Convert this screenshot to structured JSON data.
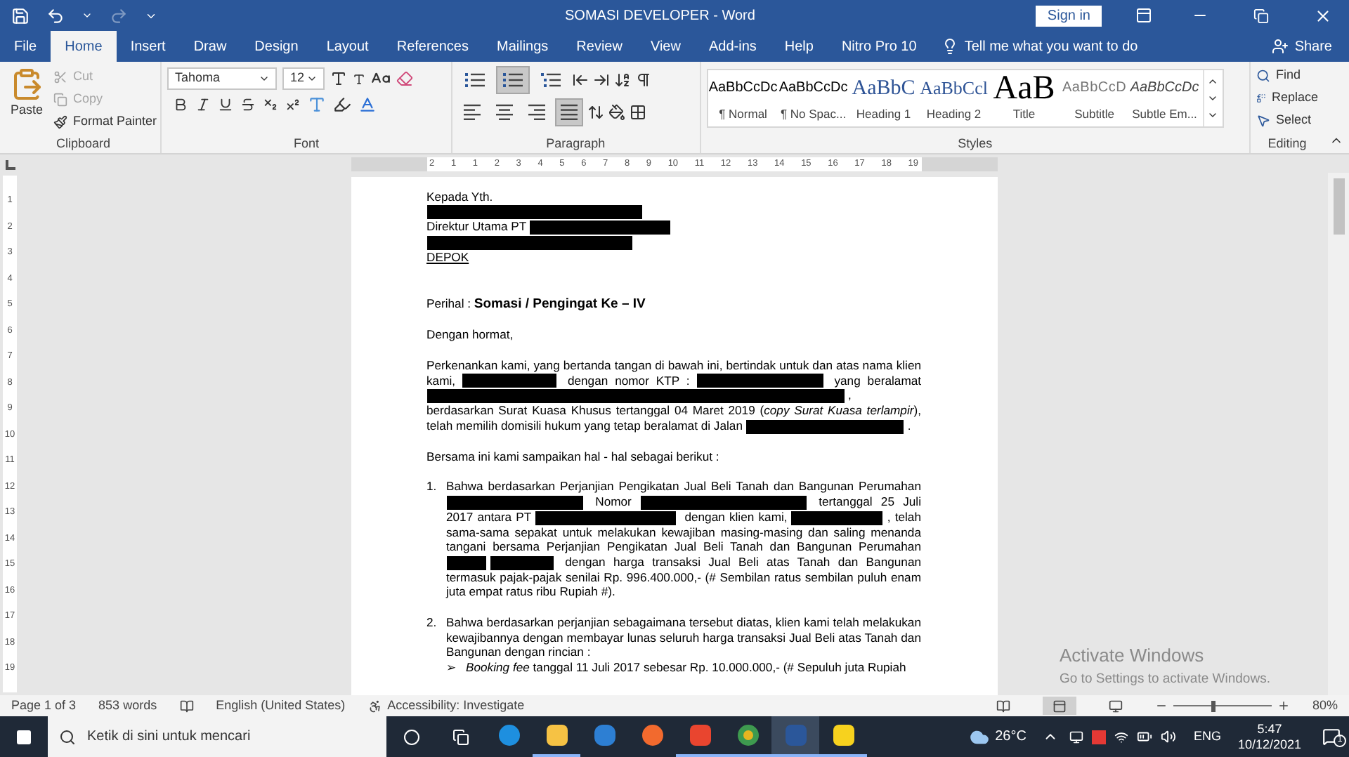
{
  "window": {
    "title": "SOMASI DEVELOPER  -  Word",
    "sign_in": "Sign in"
  },
  "tabs": [
    {
      "label": "File",
      "selected": false
    },
    {
      "label": "Home",
      "selected": true
    },
    {
      "label": "Insert",
      "selected": false
    },
    {
      "label": "Draw",
      "selected": false
    },
    {
      "label": "Design",
      "selected": false
    },
    {
      "label": "Layout",
      "selected": false
    },
    {
      "label": "References",
      "selected": false
    },
    {
      "label": "Mailings",
      "selected": false
    },
    {
      "label": "Review",
      "selected": false
    },
    {
      "label": "View",
      "selected": false
    },
    {
      "label": "Add-ins",
      "selected": false
    },
    {
      "label": "Help",
      "selected": false
    },
    {
      "label": "Nitro Pro 10",
      "selected": false
    }
  ],
  "tell_me": "Tell me what you want to do",
  "share": "Share",
  "clipboard": {
    "label": "Clipboard",
    "paste": "Paste",
    "items": [
      {
        "label": "Cut",
        "kind": "cut",
        "disabled": true
      },
      {
        "label": "Copy",
        "kind": "copy",
        "disabled": true
      },
      {
        "label": "Format Painter",
        "kind": "painter",
        "disabled": false
      }
    ]
  },
  "font": {
    "label": "Font",
    "name": "Tahoma",
    "size": "12"
  },
  "paragraph": {
    "label": "Paragraph",
    "lists": [
      {
        "kind": "bullets",
        "selected": false
      },
      {
        "kind": "numbering",
        "selected": true
      },
      {
        "kind": "multilevel",
        "selected": false
      }
    ],
    "alignment": [
      {
        "kind": "left",
        "selected": false
      },
      {
        "kind": "center",
        "selected": false
      },
      {
        "kind": "right",
        "selected": false
      },
      {
        "kind": "justify",
        "selected": true
      }
    ]
  },
  "styles": {
    "label": "Styles",
    "items": [
      {
        "preview": "AaBbCcDc",
        "name": "¶ Normal",
        "kind": "normal"
      },
      {
        "preview": "AaBbCcDc",
        "name": "¶ No Spac...",
        "kind": "nospace"
      },
      {
        "preview": "AaBbC",
        "name": "Heading 1",
        "kind": "heading1"
      },
      {
        "preview": "AaBbCcl",
        "name": "Heading 2",
        "kind": "heading2"
      },
      {
        "preview": "AaB",
        "name": "Title",
        "kind": "title"
      },
      {
        "preview": "AaBbCcD",
        "name": "Subtitle",
        "kind": "subtitle"
      },
      {
        "preview": "AaBbCcDc",
        "name": "Subtle Em...",
        "kind": "emphasis"
      }
    ]
  },
  "editing": {
    "label": "Editing",
    "items": [
      {
        "label": "Find",
        "kind": "find"
      },
      {
        "label": "Replace",
        "kind": "replace"
      },
      {
        "label": "Select",
        "kind": "select"
      }
    ]
  },
  "ruler": {
    "horizontal": [
      "2",
      "1",
      "1",
      "2",
      "3",
      "4",
      "5",
      "6",
      "7",
      "8",
      "9",
      "10",
      "11",
      "12",
      "13",
      "14",
      "15",
      "16",
      "17",
      "18",
      "19"
    ],
    "vertical": [
      "1",
      "2",
      "3",
      "4",
      "5",
      "6",
      "7",
      "8",
      "9",
      "10",
      "11",
      "12",
      "13",
      "14",
      "15",
      "16",
      "17",
      "18",
      "19"
    ]
  },
  "document": {
    "blocks": [
      {
        "kind": "line",
        "segments": [
          {
            "kind": "text",
            "text": "Kepada Yth."
          }
        ]
      },
      {
        "kind": "line",
        "segments": [
          {
            "kind": "redacted"
          }
        ]
      },
      {
        "kind": "line",
        "segments": [
          {
            "kind": "text",
            "text": "Direktur Utama PT "
          },
          {
            "kind": "redacted"
          }
        ]
      },
      {
        "kind": "line",
        "segments": [
          {
            "kind": "redacted"
          }
        ]
      },
      {
        "kind": "line",
        "segments": [
          {
            "kind": "underline",
            "text": "DEPOK"
          }
        ]
      },
      {
        "kind": "subject",
        "segments": [
          {
            "kind": "text",
            "text": "Perihal : "
          },
          {
            "kind": "bold",
            "text": "Somasi / Pengingat Ke – IV"
          }
        ]
      },
      {
        "kind": "para",
        "segments": [
          {
            "kind": "text",
            "text": "Dengan hormat,"
          }
        ]
      },
      {
        "kind": "para",
        "segments": [
          {
            "kind": "text",
            "text": "Perkenankan kami, yang bertanda tangan di bawah ini, bertindak untuk dan atas nama klien kami, "
          },
          {
            "kind": "redacted"
          },
          {
            "kind": "text",
            "text": " dengan nomor KTP : "
          },
          {
            "kind": "redacted"
          },
          {
            "kind": "text",
            "text": " yang beralamat "
          },
          {
            "kind": "redacted"
          },
          {
            "kind": "text",
            "text": ", berdasarkan Surat Kuasa Khusus tertanggal 04 Maret 2019 ("
          },
          {
            "kind": "italic",
            "text": "copy Surat Kuasa terlampir"
          },
          {
            "kind": "text",
            "text": "), telah memilih domisili hukum yang tetap beralamat di Jalan "
          },
          {
            "kind": "redacted"
          },
          {
            "kind": "text",
            "text": "."
          }
        ]
      },
      {
        "kind": "para",
        "segments": [
          {
            "kind": "text",
            "text": "Bersama ini kami sampaikan hal - hal sebagai berikut :"
          }
        ]
      },
      {
        "kind": "numbered",
        "marker": "1.",
        "segments": [
          {
            "kind": "text",
            "text": "Bahwa berdasarkan Perjanjian Pengikatan Jual Beli Tanah dan Bangunan Perumahan "
          },
          {
            "kind": "redacted"
          },
          {
            "kind": "text",
            "text": " Nomor "
          },
          {
            "kind": "redacted"
          },
          {
            "kind": "text",
            "text": " tertanggal 25 Juli 2017 antara PT "
          },
          {
            "kind": "redacted"
          },
          {
            "kind": "text",
            "text": " dengan klien kami, "
          },
          {
            "kind": "redacted"
          },
          {
            "kind": "text",
            "text": ", telah sama-sama sepakat untuk melakukan kewajiban masing-masing dan saling menanda tangani bersama Perjanjian Pengikatan Jual Beli Tanah dan Bangunan Perumahan "
          },
          {
            "kind": "redacted"
          },
          {
            "kind": "redacted"
          },
          {
            "kind": "text",
            "text": " dengan harga transaksi Jual Beli atas Tanah dan Bangunan termasuk pajak-pajak senilai Rp. 996.400.000,- (# Sembilan ratus sembilan puluh enam juta empat ratus ribu Rupiah #)."
          }
        ]
      },
      {
        "kind": "numbered",
        "marker": "2.",
        "segments": [
          {
            "kind": "text",
            "text": "Bahwa berdasarkan perjanjian sebagaimana tersebut diatas, klien kami telah melakukan kewajibannya dengan membayar lunas seluruh harga transaksi Jual Beli atas Tanah dan Bangunan dengan rincian :"
          }
        ]
      },
      {
        "kind": "bullet",
        "marker": "➢",
        "segments": [
          {
            "kind": "italic",
            "text": "Booking fee"
          },
          {
            "kind": "text",
            "text": " tanggal 11 Juli 2017 sebesar Rp. 10.000.000,- (# Sepuluh juta Rupiah"
          }
        ]
      }
    ]
  },
  "status_bar": {
    "page": "Page 1 of 3",
    "words": "853 words",
    "language": "English (United States)",
    "accessibility": "Accessibility: Investigate",
    "views": [
      {
        "kind": "read",
        "selected": false
      },
      {
        "kind": "print",
        "selected": true
      },
      {
        "kind": "web",
        "selected": false
      }
    ],
    "zoom": {
      "level": 0.39,
      "reading": "80%"
    }
  },
  "watermark": {
    "title": "Activate Windows",
    "subtitle": "Go to Settings to activate Windows."
  },
  "taskbar": {
    "search": {
      "placeholder": "Ketik di sini untuk mencari"
    },
    "apps": [
      {
        "kind": "edge",
        "open": false,
        "selected": false
      },
      {
        "kind": "explorer",
        "open": true,
        "selected": false
      },
      {
        "kind": "mail",
        "open": false,
        "selected": false
      },
      {
        "kind": "firefox",
        "open": false,
        "selected": false
      },
      {
        "kind": "nitro",
        "open": true,
        "selected": false
      },
      {
        "kind": "chrome",
        "open": true,
        "selected": false
      },
      {
        "kind": "word",
        "open": true,
        "selected": true
      },
      {
        "kind": "sticky",
        "open": true,
        "selected": false
      }
    ],
    "weather": "26°C",
    "language": "ENG",
    "time": "5:47",
    "date": "10/12/2021",
    "notifications": "1"
  }
}
